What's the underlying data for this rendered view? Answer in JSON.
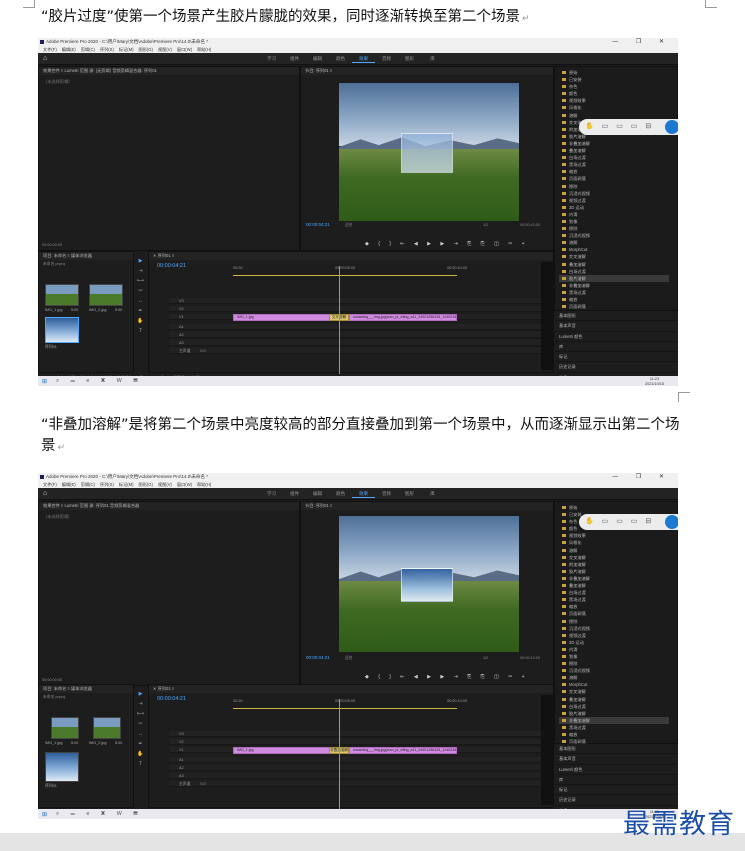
{
  "captions": {
    "caption_1": "“胶片过度”使第一个场景产生胶片朦胧的效果，同时逐渐转换至第二个场景",
    "caption_2": "“非叠加溶解”是将第二个场景中亮度较高的部分直接叠加到第一个场景中，从而逐渐显示出第二个场景",
    "para_mark": "↵"
  },
  "app": {
    "title": "Adobe Premiere Pro 2020 - C:\\用户\\Mary\\文档\\Adobe\\Premiere Pro\\14.0\\未命名 *",
    "menu": [
      "文件(F)",
      "编辑(E)",
      "剪辑(C)",
      "序列(S)",
      "标记(M)",
      "图形(G)",
      "视图(V)",
      "窗口(W)",
      "帮助(H)"
    ],
    "workspace_tabs": [
      "学习",
      "组件",
      "编辑",
      "颜色",
      "效果",
      "音频",
      "图形",
      "库"
    ],
    "active_workspace": "效果",
    "window_controls": "— ❐ ✕"
  },
  "source_panel": {
    "tabs": "效果控件 ≡    Lumetri 范围    源: (无剪辑)    音频剪辑混合器: 序列01",
    "tabs_short": "效果控件 ≡    Lumetri 范围    源: 序列01    音频剪辑混合器",
    "empty_label": "（未选择剪辑）",
    "timecode": "00:00:00:00"
  },
  "program_panel": {
    "title": "节目: 序列01 ≡",
    "timecode_1": "00:00:04:21",
    "timecode_2": "00:00:04:21",
    "fit": "适合",
    "fraction": "1/2",
    "duration": "00:00:10:00",
    "transport": "◆ { } ⇤ ◀ ▶ ▶ ⇥ ⎘ ⎘ ◫ ✂ +"
  },
  "project_panel": {
    "title": "项目: 未命名 ≡    媒体浏览器",
    "file": "未命名.prproj",
    "items": [
      {
        "name": "IMG_1.jpg",
        "dur": "5:00"
      },
      {
        "name": "IMG_2.jpg",
        "dur": "5:00"
      },
      {
        "name": "序列01",
        "dur": "10:00"
      }
    ]
  },
  "timeline": {
    "title": "✕  序列01 ≡",
    "timecode": "00:00:04:21",
    "ruler": [
      "00:00",
      "00:00:05:00",
      "00:00:10:00"
    ],
    "tracks": [
      "V3",
      "V2",
      "V1",
      "A1",
      "A2",
      "A3",
      "主声道"
    ],
    "master_value": "0.0",
    "clip_1": "IMG_1.jpg",
    "clip_2": "snownlkq___img,jpg(cum_pi_xiling_a11_24021256125_12402345d129-3-1300,jpg(size=96x...)",
    "transition_1": "交叉溶解",
    "transition_2": "非叠加溶解"
  },
  "effects_tree": {
    "items_1": [
      "原始",
      "已安装",
      "杂色",
      "颜色",
      "视频效果",
      "风格化",
      "溶解",
      "交叉溶解",
      "附加溶解",
      "胶片溶解",
      "非叠加溶解",
      "叠加溶解",
      "白场过渡",
      "黑场过渡",
      "缩放",
      "页面剥落",
      "擦除",
      "沉浸式视频",
      "视频过渡",
      "3D 运动",
      "内滑",
      "划像",
      "擦除",
      "沉浸式视频",
      "溶解",
      "MorphCut",
      "交叉溶解",
      "叠加溶解",
      "白场过渡",
      "胶片溶解",
      "非叠加溶解",
      "黑场过渡",
      "缩放",
      "页面剥落"
    ],
    "selected_1": 29,
    "items_2": [
      "原始",
      "已安装",
      "杂色",
      "颜色",
      "视频效果",
      "风格化",
      "溶解",
      "交叉溶解",
      "附加溶解",
      "胶片溶解",
      "非叠加溶解",
      "叠加溶解",
      "白场过渡",
      "黑场过渡",
      "缩放",
      "页面剥落",
      "擦除",
      "沉浸式视频",
      "视频过渡",
      "3D 运动",
      "内滑",
      "划像",
      "擦除",
      "沉浸式视频",
      "溶解",
      "MorphCut",
      "交叉溶解",
      "叠加溶解",
      "白场过渡",
      "胶片溶解",
      "非叠加溶解",
      "黑场过渡",
      "缩放",
      "页面剥落"
    ],
    "selected_2": 30
  },
  "side_sections": [
    "基本图形",
    "基本声音",
    "Lumetri 颜色",
    "库",
    "标记",
    "历史记录",
    "信息"
  ],
  "status_text": "单击以选择，或单击空白处并拖动以进行框选。使用 Shift、Alt 和 Ctrl 可获得其他选项。",
  "taskbar": {
    "time": "11:23",
    "date": "2021/10/15"
  },
  "watermark": "最需教育"
}
